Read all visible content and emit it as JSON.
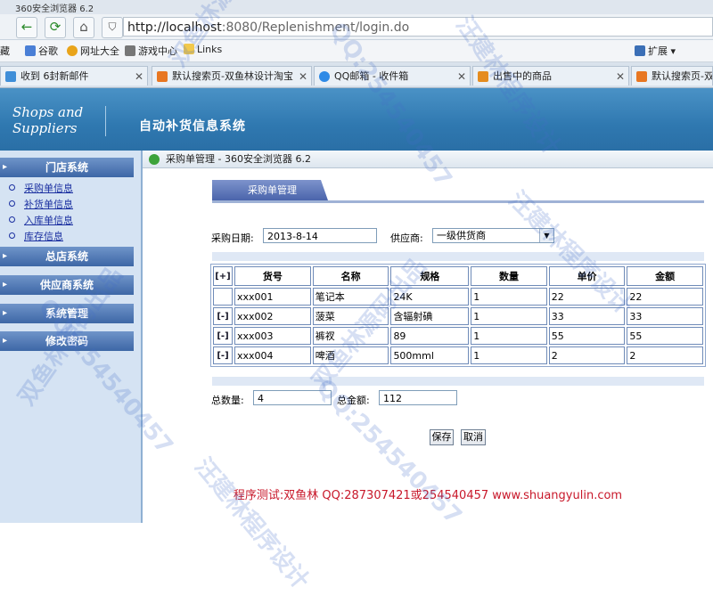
{
  "browser": {
    "title": "360安全浏览器 6.2",
    "url_host": "http://localhost",
    "url_rest": ":8080/Replenishment/login.do",
    "bookmarks": [
      "谷歌",
      "网址大全",
      "游戏中心",
      "Links"
    ],
    "bookmarks_left": "藏",
    "extensions": "扩展",
    "tabs": [
      "收到 6封新邮件",
      "默认搜索页-双鱼林设计淘宝",
      "QQ邮箱 - 收件箱",
      "出售中的商品",
      "默认搜索页-双鱼林设"
    ]
  },
  "app": {
    "logo_line1": "Shops and",
    "logo_line2": "Suppliers",
    "system_title": "自动补货信息系统"
  },
  "sidebar": {
    "store_system": "门店系统",
    "store_items": [
      "采购单信息",
      "补货单信息",
      "入库单信息",
      "库存信息"
    ],
    "head_office": "总店系统",
    "supplier_system": "供应商系统",
    "system_admin": "系统管理",
    "change_password": "修改密码"
  },
  "window": {
    "title": "采购单管理 - 360安全浏览器 6.2",
    "tab_label": "采购单管理"
  },
  "form": {
    "date_label": "采购日期:",
    "date_value": "2013-8-14",
    "supplier_label": "供应商:",
    "supplier_value": "一级供货商"
  },
  "table": {
    "add_button": "[+]",
    "remove_button": "[-]",
    "headers": [
      "货号",
      "名称",
      "规格",
      "数量",
      "单价",
      "金额"
    ],
    "rows": [
      [
        "xxx001",
        "笔记本",
        "24K",
        "1",
        "22",
        "22"
      ],
      [
        "xxx002",
        "菠菜",
        "含辐射碘",
        "1",
        "33",
        "33"
      ],
      [
        "xxx003",
        "裤衩",
        "89",
        "1",
        "55",
        "55"
      ],
      [
        "xxx004",
        "啤酒",
        "500mml",
        "1",
        "2",
        "2"
      ]
    ]
  },
  "totals": {
    "qty_label": "总数量:",
    "qty_value": "4",
    "amount_label": "总金额:",
    "amount_value": "112"
  },
  "actions": {
    "save": "保存",
    "cancel": "取消"
  },
  "footer": "程序测试:双鱼林 QQ:287307421或254540457 www.shuangyulin.com",
  "watermarks": [
    "汪建林程序设计",
    "双鱼林源码出品",
    "QQ:254540457",
    "双鱼林源码出品",
    "QQ:254540457",
    "汪建林程序设计",
    "双鱼林源码出品",
    "QQ:254540457",
    "汪建林程序设计"
  ],
  "colors": {
    "header_blue": "#2f78b0",
    "menu_blue": "#3d67a6",
    "link_blue": "#1a2fa0",
    "footer_red": "#c8182a"
  }
}
